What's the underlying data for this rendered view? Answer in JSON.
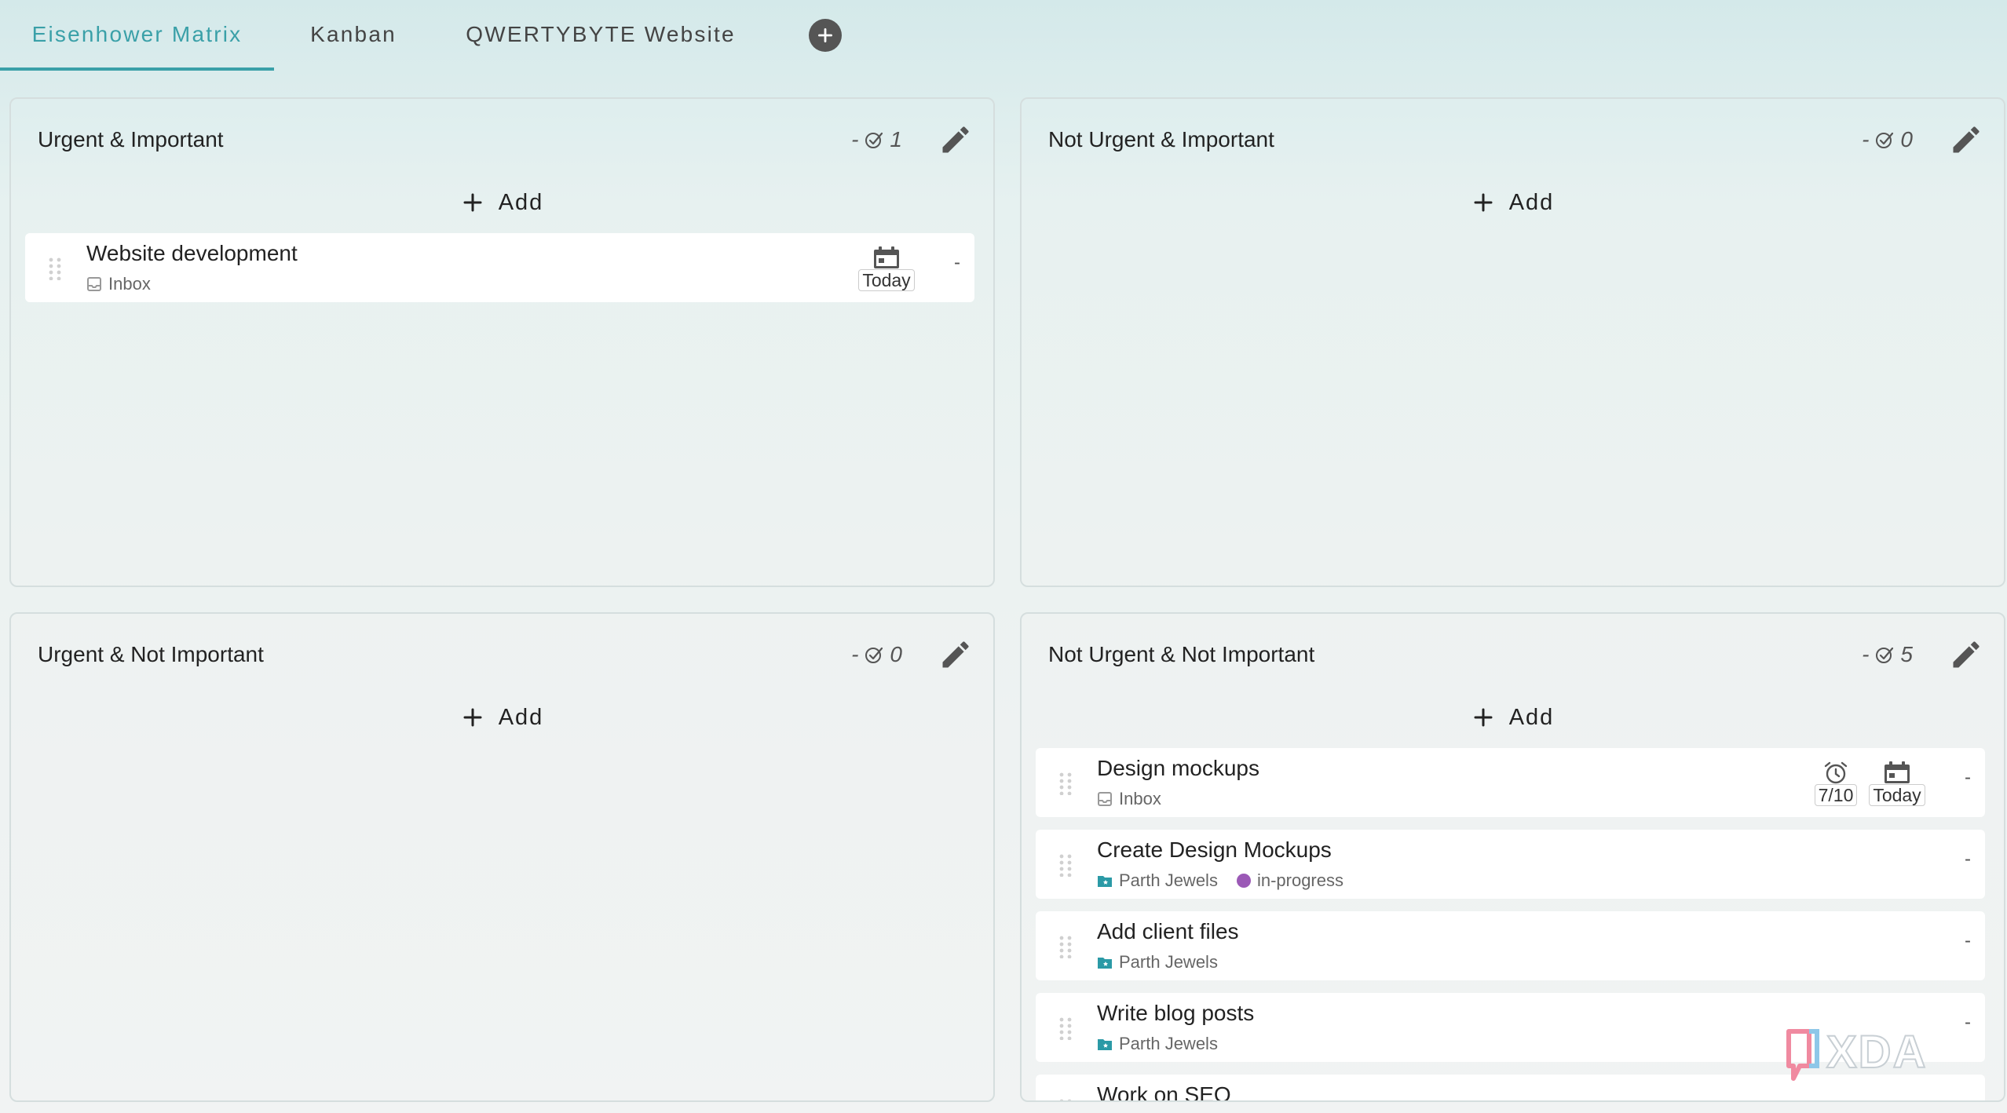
{
  "tabs": [
    {
      "label": "Eisenhower Matrix",
      "active": true
    },
    {
      "label": "Kanban",
      "active": false
    },
    {
      "label": "QWERTYBYTE Website",
      "active": false
    }
  ],
  "add_tab_icon": "plus-circle-icon",
  "colors": {
    "accent": "#3aa0a8",
    "project_folder": "#2b9aa6",
    "tag_in_progress": "#9b59b6"
  },
  "quadrants": [
    {
      "title": "Urgent & Important",
      "count_prefix": "-",
      "count": "1",
      "add_label": "Add",
      "tasks": [
        {
          "title": "Website development",
          "project": "Inbox",
          "project_icon": "inbox-icon",
          "due": "Today",
          "priority": "-"
        }
      ]
    },
    {
      "title": "Not Urgent & Important",
      "count_prefix": "-",
      "count": "0",
      "add_label": "Add",
      "tasks": []
    },
    {
      "title": "Urgent & Not Important",
      "count_prefix": "-",
      "count": "0",
      "add_label": "Add",
      "tasks": []
    },
    {
      "title": "Not Urgent & Not Important",
      "count_prefix": "-",
      "count": "5",
      "add_label": "Add",
      "tasks": [
        {
          "title": "Design mockups",
          "project": "Inbox",
          "project_icon": "inbox-icon",
          "reminder": "7/10",
          "due": "Today",
          "priority": "-"
        },
        {
          "title": "Create Design Mockups",
          "project": "Parth Jewels",
          "project_icon": "project-folder-icon",
          "tag": "in-progress",
          "priority": "-"
        },
        {
          "title": "Add client files",
          "project": "Parth Jewels",
          "project_icon": "project-folder-icon",
          "priority": "-"
        },
        {
          "title": "Write blog posts",
          "project": "Parth Jewels",
          "project_icon": "project-folder-icon",
          "priority": "-"
        },
        {
          "title": "Work on SEO"
        }
      ]
    }
  ],
  "watermark": "XDA"
}
